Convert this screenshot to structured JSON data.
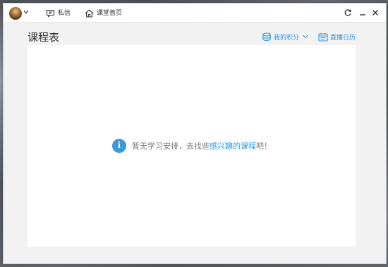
{
  "titlebar": {
    "nav": [
      {
        "label": "私信",
        "icon": "message-icon"
      },
      {
        "label": "课堂首页",
        "icon": "home-icon"
      }
    ],
    "controls": [
      "refresh-icon",
      "minimize-icon",
      "close-icon"
    ]
  },
  "page": {
    "title": "课程表",
    "points_label": "我的积分",
    "calendar_label": "直播日历"
  },
  "empty_state": {
    "prefix": "暂无学习安排，去找些",
    "link": "感兴趣的课程",
    "suffix": "吧！"
  },
  "colors": {
    "accent": "#2a96e6",
    "info": "#3e98d8"
  }
}
